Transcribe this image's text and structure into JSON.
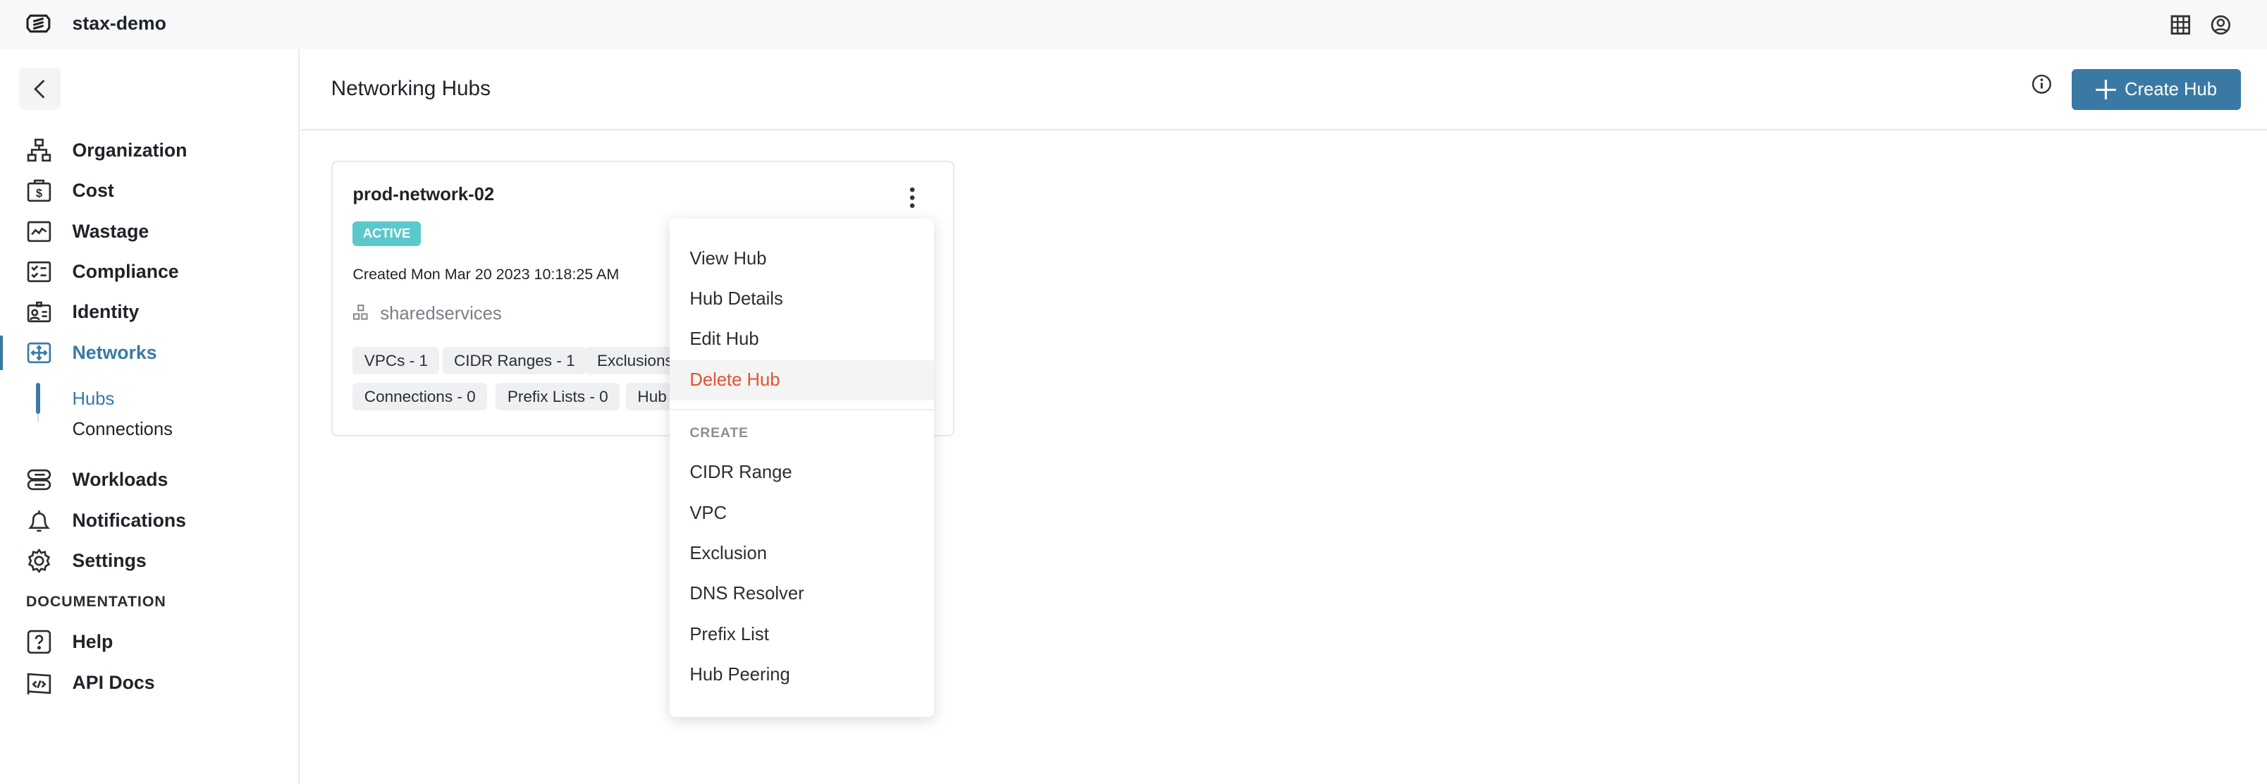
{
  "topbar": {
    "org_name": "stax-demo",
    "icons": [
      "stax-logo-icon",
      "apps-grid-icon",
      "user-account-icon"
    ]
  },
  "sidebar": {
    "items": [
      {
        "label": "Organization",
        "icon": "organization-icon"
      },
      {
        "label": "Cost",
        "icon": "cost-icon"
      },
      {
        "label": "Wastage",
        "icon": "wastage-icon"
      },
      {
        "label": "Compliance",
        "icon": "compliance-icon"
      },
      {
        "label": "Identity",
        "icon": "identity-icon"
      },
      {
        "label": "Networks",
        "icon": "networks-icon",
        "active": true
      }
    ],
    "sub_items": [
      {
        "label": "Hubs",
        "active": true
      },
      {
        "label": "Connections"
      }
    ],
    "items2": [
      {
        "label": "Workloads",
        "icon": "workloads-icon"
      },
      {
        "label": "Notifications",
        "icon": "bell-icon"
      },
      {
        "label": "Settings",
        "icon": "gear-icon"
      }
    ],
    "doc_heading": "DOCUMENTATION",
    "doc_items": [
      {
        "label": "Help",
        "icon": "help-icon"
      },
      {
        "label": "API Docs",
        "icon": "api-docs-icon"
      }
    ]
  },
  "header": {
    "title": "Networking Hubs",
    "create_label": "Create Hub"
  },
  "hub": {
    "name": "prod-network-02",
    "status": "ACTIVE",
    "status_color": "#5bc8cc",
    "created": "Created Mon Mar 20 2023 10:18:25 AM",
    "account": "sharedservices",
    "chips_row1": [
      "VPCs - 1",
      "CIDR Ranges - 1",
      "Exclusions"
    ],
    "chips_row2": [
      "Connections - 0",
      "Prefix Lists - 0",
      "Hub"
    ]
  },
  "menu": {
    "actions": [
      "View Hub",
      "Hub Details",
      "Edit Hub",
      "Delete Hub"
    ],
    "create_heading": "CREATE",
    "create_items": [
      "CIDR Range",
      "VPC",
      "Exclusion",
      "DNS Resolver",
      "Prefix List",
      "Hub Peering"
    ],
    "danger_color": "#e0532e"
  },
  "colors": {
    "accent": "#3a79a3"
  }
}
